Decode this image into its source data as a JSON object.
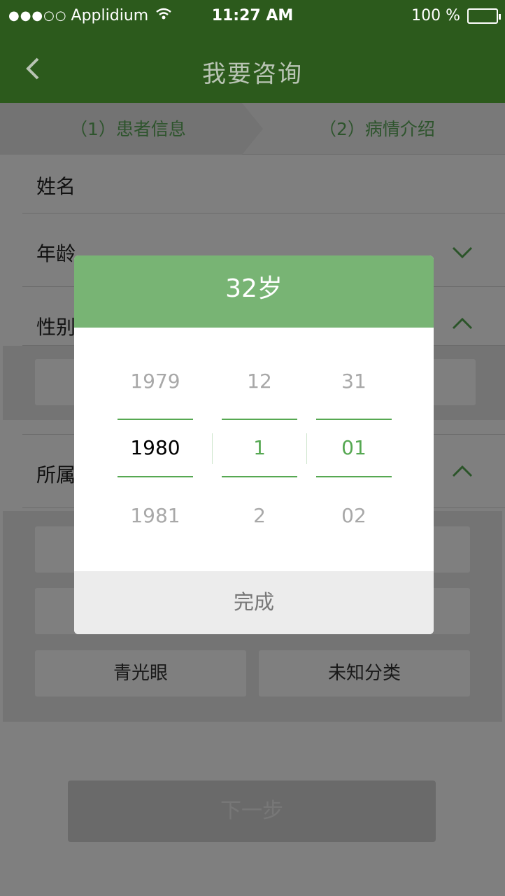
{
  "status_bar": {
    "carrier": "Applidium",
    "signal_dots": "●●●○○",
    "time": "11:27 AM",
    "battery": "100 %"
  },
  "nav": {
    "title": "我要咨询"
  },
  "steps": [
    {
      "label": "（1）患者信息"
    },
    {
      "label": "（2）病情介绍"
    }
  ],
  "form": {
    "name_label": "姓名",
    "age_label": "年龄",
    "gender_label": "性别",
    "category_label": "所属",
    "category_tags": [
      "青光眼",
      "未知分类"
    ]
  },
  "next_button": "下一步",
  "picker": {
    "title": "32岁",
    "years": [
      "1979",
      "1980",
      "1981"
    ],
    "months": [
      "12",
      "1",
      "2"
    ],
    "days": [
      "31",
      "01",
      "02"
    ],
    "done": "完成"
  },
  "colors": {
    "nav_green": "#2c5a1c",
    "accent_green": "#56a852",
    "header_green": "#78b474"
  }
}
